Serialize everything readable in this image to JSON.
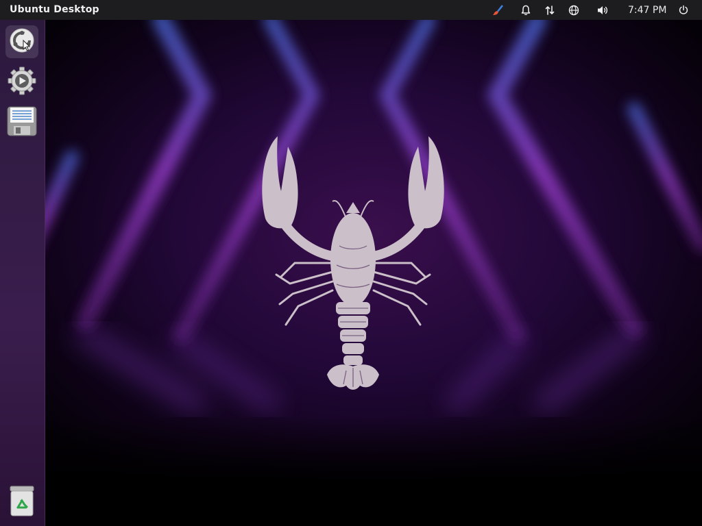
{
  "topbar": {
    "title": "Ubuntu Desktop",
    "clock": "7:47 PM",
    "indicators": [
      "paintbrush-icon",
      "bell-icon",
      "network-transfer-icon",
      "globe-icon",
      "speaker-volume-icon",
      "power-icon"
    ]
  },
  "dock": {
    "items": [
      "installer-icon",
      "settings-gear-icon",
      "document-save-icon",
      "trash-recycle-icon"
    ]
  },
  "colors": {
    "topbar": "#1d1d1f",
    "dock": "#3a1d4d",
    "wallpaper_accent": "#a44bd6",
    "lobster": "#cbbfc9"
  }
}
